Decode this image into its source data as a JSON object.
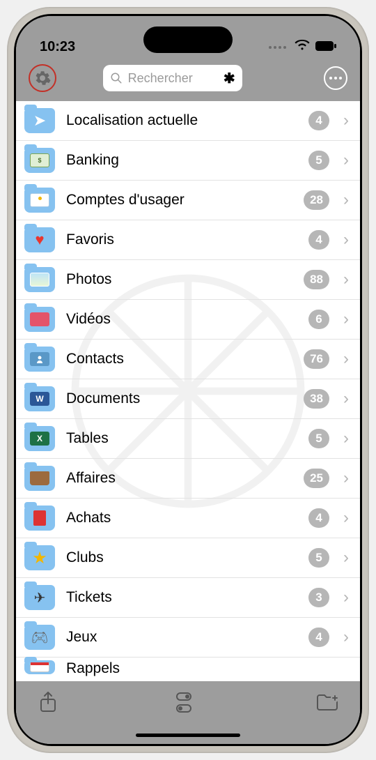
{
  "status": {
    "time": "10:23"
  },
  "toolbar": {
    "search_placeholder": "Rechercher"
  },
  "folders": [
    {
      "icon": "location",
      "label": "Localisation actuelle",
      "count": 4
    },
    {
      "icon": "banking",
      "label": "Banking",
      "count": 5
    },
    {
      "icon": "user-accounts",
      "label": "Comptes d'usager",
      "count": 28
    },
    {
      "icon": "favorites",
      "label": "Favoris",
      "count": 4
    },
    {
      "icon": "photos",
      "label": "Photos",
      "count": 88
    },
    {
      "icon": "videos",
      "label": "Vidéos",
      "count": 6
    },
    {
      "icon": "contacts",
      "label": "Contacts",
      "count": 76
    },
    {
      "icon": "documents",
      "label": "Documents",
      "count": 38
    },
    {
      "icon": "tables",
      "label": "Tables",
      "count": 5
    },
    {
      "icon": "business",
      "label": "Affaires",
      "count": 25
    },
    {
      "icon": "shopping",
      "label": "Achats",
      "count": 4
    },
    {
      "icon": "clubs",
      "label": "Clubs",
      "count": 5
    },
    {
      "icon": "tickets",
      "label": "Tickets",
      "count": 3
    },
    {
      "icon": "games",
      "label": "Jeux",
      "count": 4
    },
    {
      "icon": "reminders",
      "label": "Rappels",
      "count": null
    }
  ]
}
